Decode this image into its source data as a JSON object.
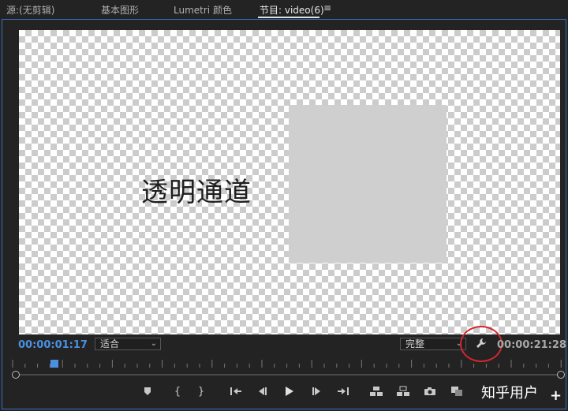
{
  "tabs": [
    {
      "label": "源:(无剪辑)"
    },
    {
      "label": "基本图形"
    },
    {
      "label": "Lumetri 颜色"
    },
    {
      "label": "节目: video(6)"
    }
  ],
  "panel_menu_glyph": "≡",
  "canvas": {
    "text": "透明通道"
  },
  "timecode": {
    "current": "00:00:01:17",
    "duration": "00:00:21:28"
  },
  "zoom_select": {
    "value": "适合"
  },
  "resolution_select": {
    "value": "完整"
  },
  "playhead_position": 0.07,
  "watermark": {
    "text": "知乎用户",
    "plus": "+"
  },
  "controls": [
    {
      "name": "add-marker-button",
      "glyph": "⬇"
    },
    {
      "name": "mark-in-button",
      "glyph": "{"
    },
    {
      "name": "mark-out-button",
      "glyph": "}"
    },
    {
      "name": "go-to-in-button",
      "glyph": "|←"
    },
    {
      "name": "step-back-button",
      "glyph": "◀|"
    },
    {
      "name": "play-button",
      "glyph": "▶"
    },
    {
      "name": "step-forward-button",
      "glyph": "|▶"
    },
    {
      "name": "go-to-out-button",
      "glyph": "→|"
    },
    {
      "name": "lift-button",
      "glyph": "⊥"
    },
    {
      "name": "extract-button",
      "glyph": "⊥"
    },
    {
      "name": "export-frame-button",
      "glyph": "📷"
    },
    {
      "name": "comparison-view-button",
      "glyph": "▣"
    }
  ],
  "accent": "#4a90e2",
  "annotation_circle_color": "#d3272d"
}
